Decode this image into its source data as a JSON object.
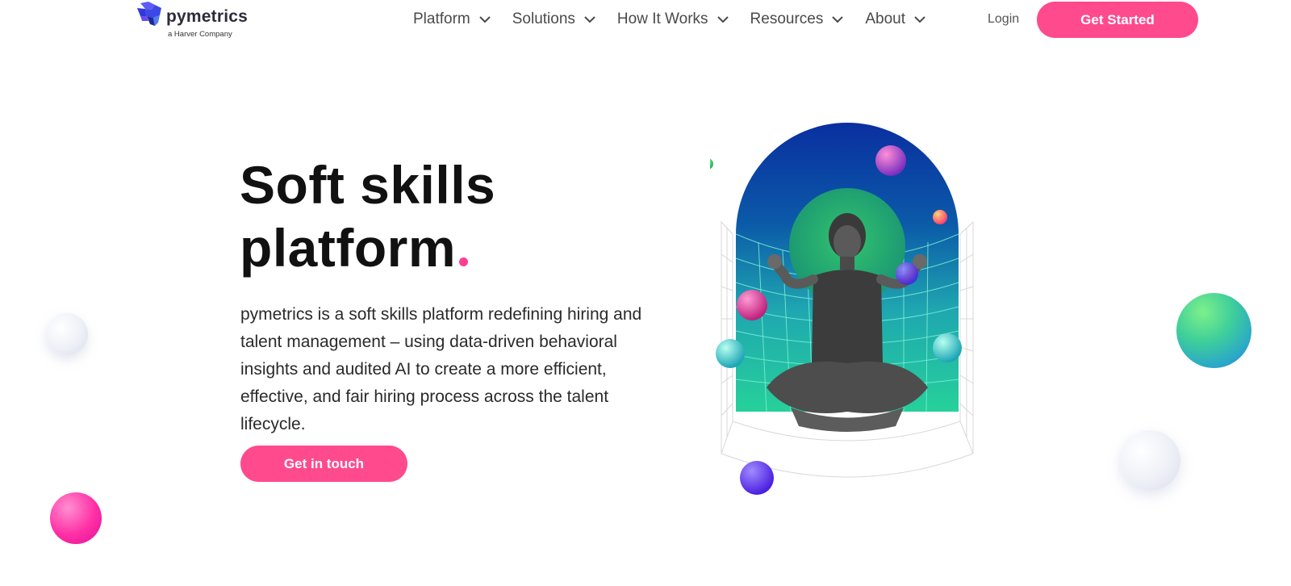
{
  "header": {
    "logo": {
      "name": "pymetrics",
      "subtitle": "a Harver Company"
    },
    "nav": [
      {
        "label": "Platform"
      },
      {
        "label": "Solutions"
      },
      {
        "label": "How It Works"
      },
      {
        "label": "Resources"
      },
      {
        "label": "About"
      }
    ],
    "login_label": "Login",
    "get_started_label": "Get Started"
  },
  "hero": {
    "title_line1": "Soft skills",
    "title_line2": "platform",
    "description": "pymetrics is a soft skills platform redefining hiring and talent management – using data-driven behavioral insights and audited AI to create a more efficient, effective, and fair hiring process across the talent lifecycle.",
    "cta_label": "Get in touch"
  },
  "colors": {
    "brand_pink": "#ff4a8d",
    "title_dot": "#ff3d95",
    "arch_top": "#0a2fa0",
    "arch_bottom": "#26d19a"
  },
  "icons": [
    "logo-mark-icon",
    "chevron-down-icon"
  ]
}
